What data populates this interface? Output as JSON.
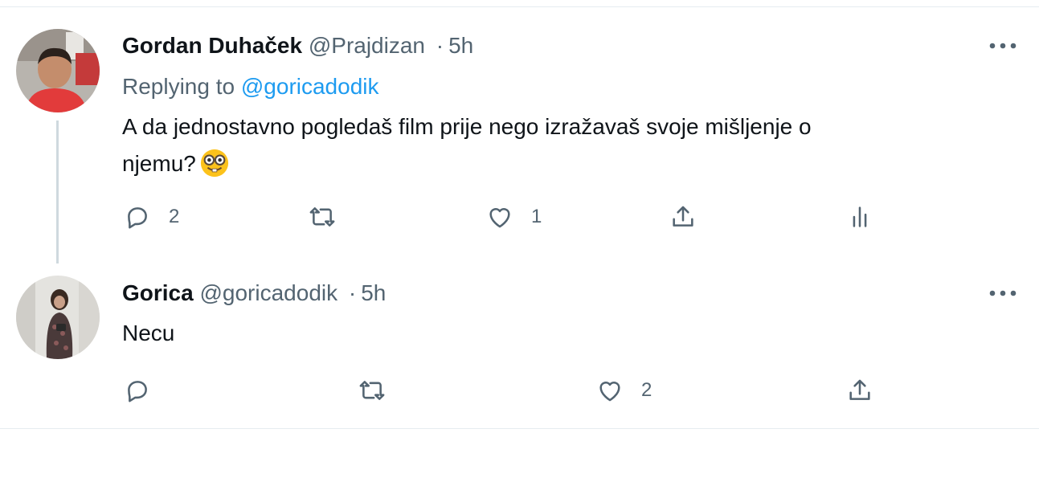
{
  "tweets": [
    {
      "display_name": "Gordan Duhaček",
      "handle": "@Prajdizan",
      "separator": "·",
      "time": "5h",
      "replying_label": "Replying to",
      "replying_handle": "@goricadodik",
      "text_line1": "A da jednostavno pogledaš film prije nego izražavaš svoje mišljenje o",
      "text_line2": "njemu?",
      "emoji": "nerd-face-emoji",
      "actions": {
        "reply_count": "2",
        "retweet_count": "",
        "like_count": "1"
      }
    },
    {
      "display_name": "Gorica",
      "handle": "@goricadodik",
      "separator": "·",
      "time": "5h",
      "text_line1": "Necu",
      "actions": {
        "reply_count": "",
        "retweet_count": "",
        "like_count": "2"
      }
    }
  ],
  "colors": {
    "text_primary": "#0f1419",
    "text_secondary": "#536471",
    "link": "#1d9bf0",
    "divider": "#e6ecf0",
    "thread_line": "#cfd9de"
  },
  "icons": [
    "reply-icon",
    "retweet-icon",
    "like-icon",
    "share-icon",
    "analytics-icon",
    "more-icon"
  ]
}
